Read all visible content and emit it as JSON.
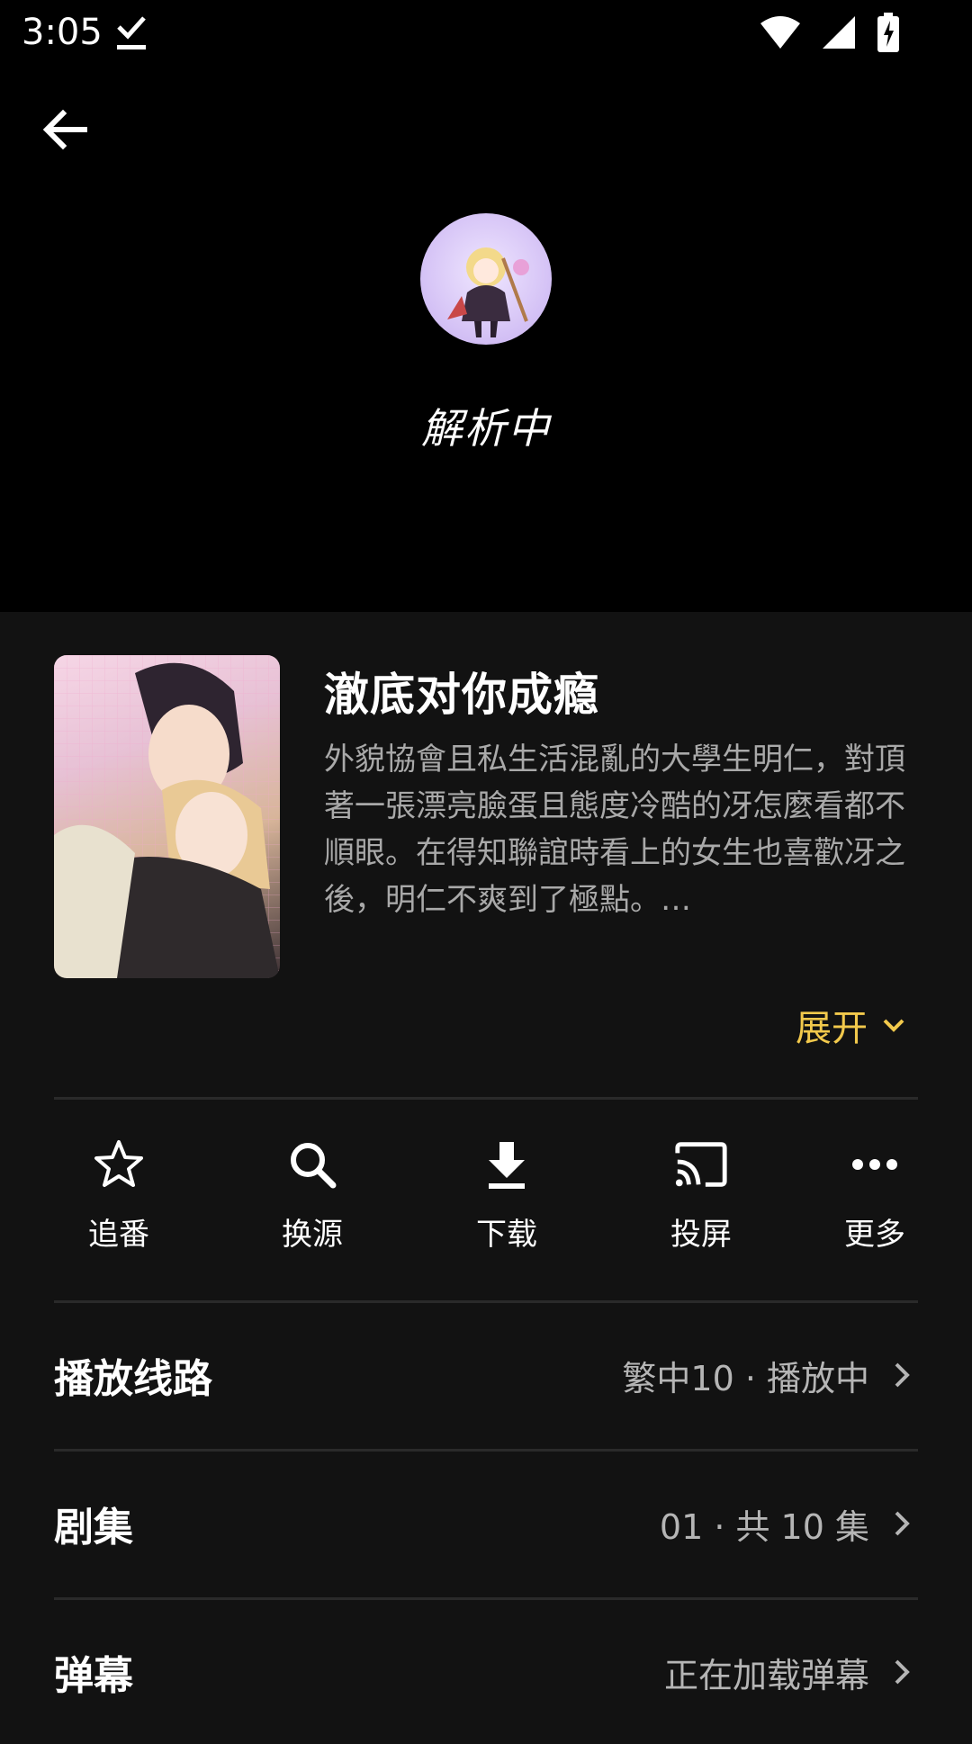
{
  "status_bar": {
    "time": "3:05",
    "icons": [
      "download-done-icon",
      "wifi-icon",
      "signal-icon",
      "battery-charging-icon"
    ]
  },
  "player": {
    "back_icon": "arrow-left-icon",
    "status_text": "解析中"
  },
  "show": {
    "title": "澈底对你成瘾",
    "description": "外貌協會且私生活混亂的大學生明仁，對頂著一張漂亮臉蛋且態度冷酷的冴怎麼看都不順眼。在得知聯誼時看上的女生也喜歡冴之後，明仁不爽到了極點。…",
    "expand_label": "展开",
    "accent_color": "#f2c94c"
  },
  "actions": [
    {
      "label": "追番",
      "icon": "star-outline-icon"
    },
    {
      "label": "换源",
      "icon": "search-icon"
    },
    {
      "label": "下载",
      "icon": "download-icon"
    },
    {
      "label": "投屏",
      "icon": "cast-icon"
    },
    {
      "label": "更多",
      "icon": "more-horiz-icon"
    }
  ],
  "rows": [
    {
      "title": "播放线路",
      "value": "繁中10 · 播放中"
    },
    {
      "title": "剧集",
      "value": "01 · 共 10 集"
    },
    {
      "title": "弹幕",
      "value": "正在加载弹幕"
    }
  ]
}
